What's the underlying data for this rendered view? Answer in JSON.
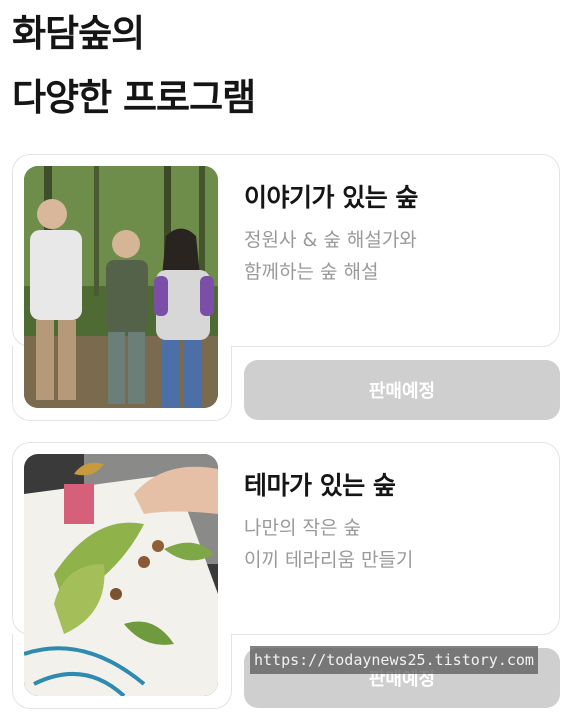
{
  "heading": {
    "line1": "화담숲의",
    "line2": "다양한 프로그램"
  },
  "programs": [
    {
      "title": "이야기가 있는 숲",
      "desc_line1": "정원사 & 숲 해설가와",
      "desc_line2": "함께하는 숲 해설",
      "status": "판매예정"
    },
    {
      "title": "테마가 있는 숲",
      "desc_line1": "나만의 작은 숲",
      "desc_line2": "이끼 테라리움 만들기",
      "status": "판매예정"
    }
  ],
  "watermark": "https://todaynews25.tistory.com",
  "colors": {
    "button_bg": "#cfcfcf",
    "desc_text": "#9a9a9a",
    "border": "#e3e3e3"
  }
}
